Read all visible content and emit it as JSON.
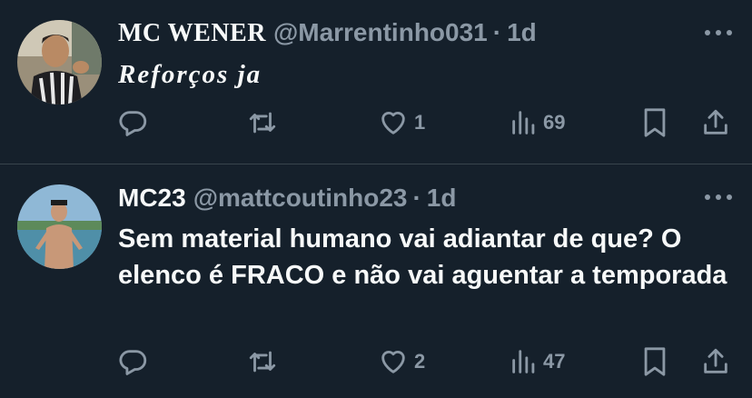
{
  "tweets": [
    {
      "display_name": "MC WENER",
      "handle": "@Marrentinho031",
      "separator": "·",
      "time": "1d",
      "text": "Reforços ja",
      "actions": {
        "reply_count": "",
        "retweet_count": "",
        "like_count": "1",
        "view_count": "69"
      }
    },
    {
      "display_name": "MC23",
      "handle": "@mattcoutinho23",
      "separator": "·",
      "time": "1d",
      "text": "Sem material humano vai adiantar de que? O elenco é FRACO e não vai aguentar a temporada",
      "actions": {
        "reply_count": "",
        "retweet_count": "",
        "like_count": "2",
        "view_count": "47"
      }
    }
  ],
  "icons": {
    "reply": "reply-icon",
    "retweet": "retweet-icon",
    "like": "heart-icon",
    "views": "views-icon",
    "bookmark": "bookmark-icon",
    "share": "share-icon",
    "more": "more-icon"
  },
  "colors": {
    "background": "#15202b",
    "text_primary": "#f7f9f9",
    "text_secondary": "#8b98a5",
    "divider": "#38444d"
  }
}
